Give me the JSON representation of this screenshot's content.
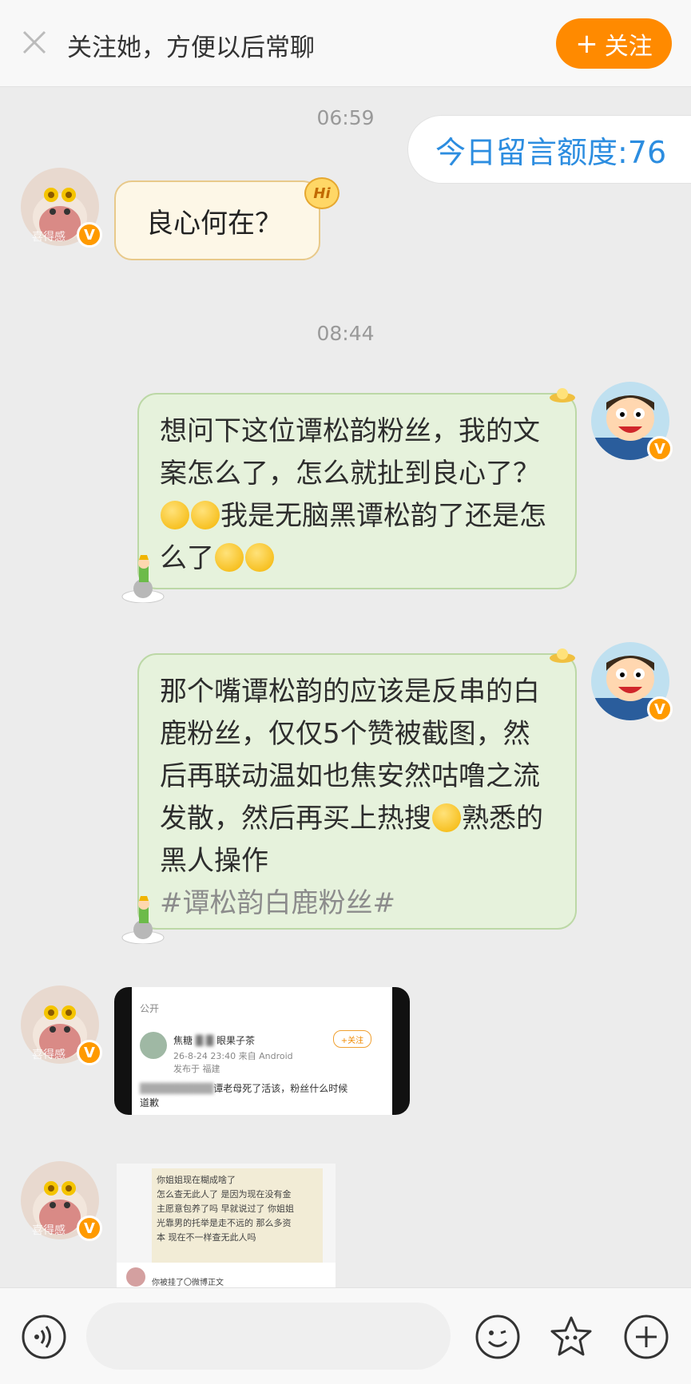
{
  "topbar": {
    "prompt": "关注她，方便以后常聊",
    "follow_label": "关注",
    "follow_plus": "+"
  },
  "quota_text": "今日留言额度:76",
  "times": [
    "06:59",
    "08:44"
  ],
  "messages": {
    "m1": "良心何在？",
    "hi_badge": "Hi",
    "m2_parts": [
      "想问下这位谭松韵粉丝，我的文案怎么了，怎么就扯到良心了？",
      "我是无脑黑谭松韵了还是怎么了"
    ],
    "m3_parts": [
      "那个嘴谭松韵的应该是反串的白鹿粉丝，仅仅5个赞被截图，然后再联动温如也焦安然咕噜之流发散，然后再买上热搜",
      "熟悉的黑人操作"
    ],
    "m3_hashtag": "#谭松韵白鹿粉丝#"
  },
  "avatar_label": "喜得感",
  "image1": {
    "visibility": "公开",
    "name": "焦糖",
    "name_suffix": "眼果子茶",
    "meta": "26-8-24 23:40  来自 Android",
    "location": "发布于 福建",
    "follow": "+关注",
    "text_a": "谭老母死了活该，粉丝什么时候",
    "text_b": "道歉"
  },
  "image2": {
    "lines": [
      "你姐姐现在糊成啥了",
      "怎么查无此人了 是因为现在没有金",
      "主愿意包养了吗 早就说过了 你姐姐",
      "光靠男的托举是走不远的 那么多资",
      "本 现在不一样查无此人吗"
    ],
    "footer": "你被挂了〇微博正文"
  },
  "colors": {
    "accent_orange": "#ff8a00",
    "quota_blue": "#2c8de0",
    "bubble_green": "#e6f2dc",
    "bubble_yellow": "#fdf7e7"
  }
}
